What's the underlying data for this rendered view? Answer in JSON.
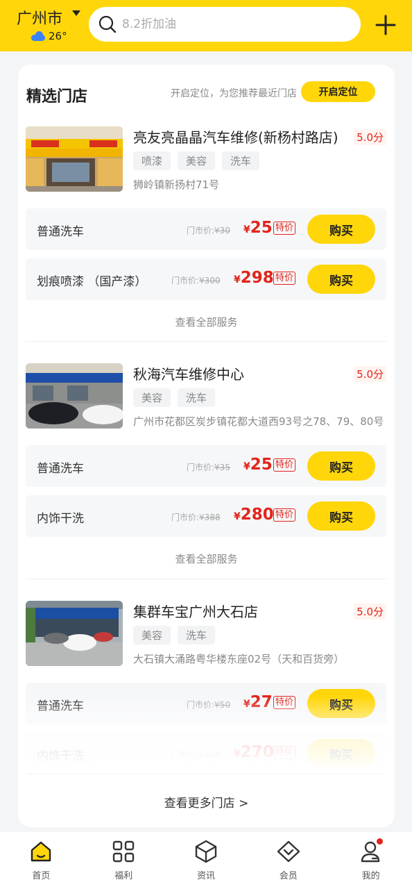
{
  "header": {
    "city": "广州市",
    "temperature": "26°",
    "search_placeholder": "8.2折加油"
  },
  "featured": {
    "title": "精选门店",
    "location_hint": "开启定位，为您推荐最近门店",
    "location_button": "开启定位",
    "market_label": "门市价:",
    "currency": "¥",
    "special_badge": "特价",
    "buy_label": "购买",
    "see_all_label": "查看全部服务",
    "stores": [
      {
        "name": "亮友亮晶晶汽车维修(新杨村路店)",
        "score": "5.0分",
        "tags": [
          "喷漆",
          "美容",
          "洗车"
        ],
        "address": "狮岭镇新扬村71号",
        "services": [
          {
            "name": "普通洗车",
            "market_price": "¥30",
            "price": "25"
          },
          {
            "name": "划痕喷漆 （国产漆）",
            "market_price": "¥300",
            "price": "298"
          }
        ]
      },
      {
        "name": "秋海汽车维修中心",
        "score": "5.0分",
        "tags": [
          "美容",
          "洗车"
        ],
        "address": "广州市花都区炭步镇花都大道西93号之78、79、80号",
        "services": [
          {
            "name": "普通洗车",
            "market_price": "¥35",
            "price": "25"
          },
          {
            "name": "内饰干洗",
            "market_price": "¥388",
            "price": "280"
          }
        ]
      },
      {
        "name": "集群车宝广州大石店",
        "score": "5.0分",
        "tags": [
          "美容",
          "洗车"
        ],
        "address": "大石镇大涌路粤华楼东座02号（天和百货旁）",
        "services": [
          {
            "name": "普通洗车",
            "market_price": "¥50",
            "price": "27"
          },
          {
            "name": "内饰干洗",
            "market_price": "¥368",
            "price": "270"
          }
        ]
      }
    ],
    "more_stores": "查看更多门店 >"
  },
  "tabs": [
    {
      "label": "首页",
      "icon": "home-icon",
      "active": true
    },
    {
      "label": "福利",
      "icon": "grid-icon"
    },
    {
      "label": "资讯",
      "icon": "cube-icon"
    },
    {
      "label": "会员",
      "icon": "diamond-icon"
    },
    {
      "label": "我的",
      "icon": "profile-icon"
    }
  ],
  "colors": {
    "brand": "#ffd60a",
    "price": "#e1251b"
  }
}
